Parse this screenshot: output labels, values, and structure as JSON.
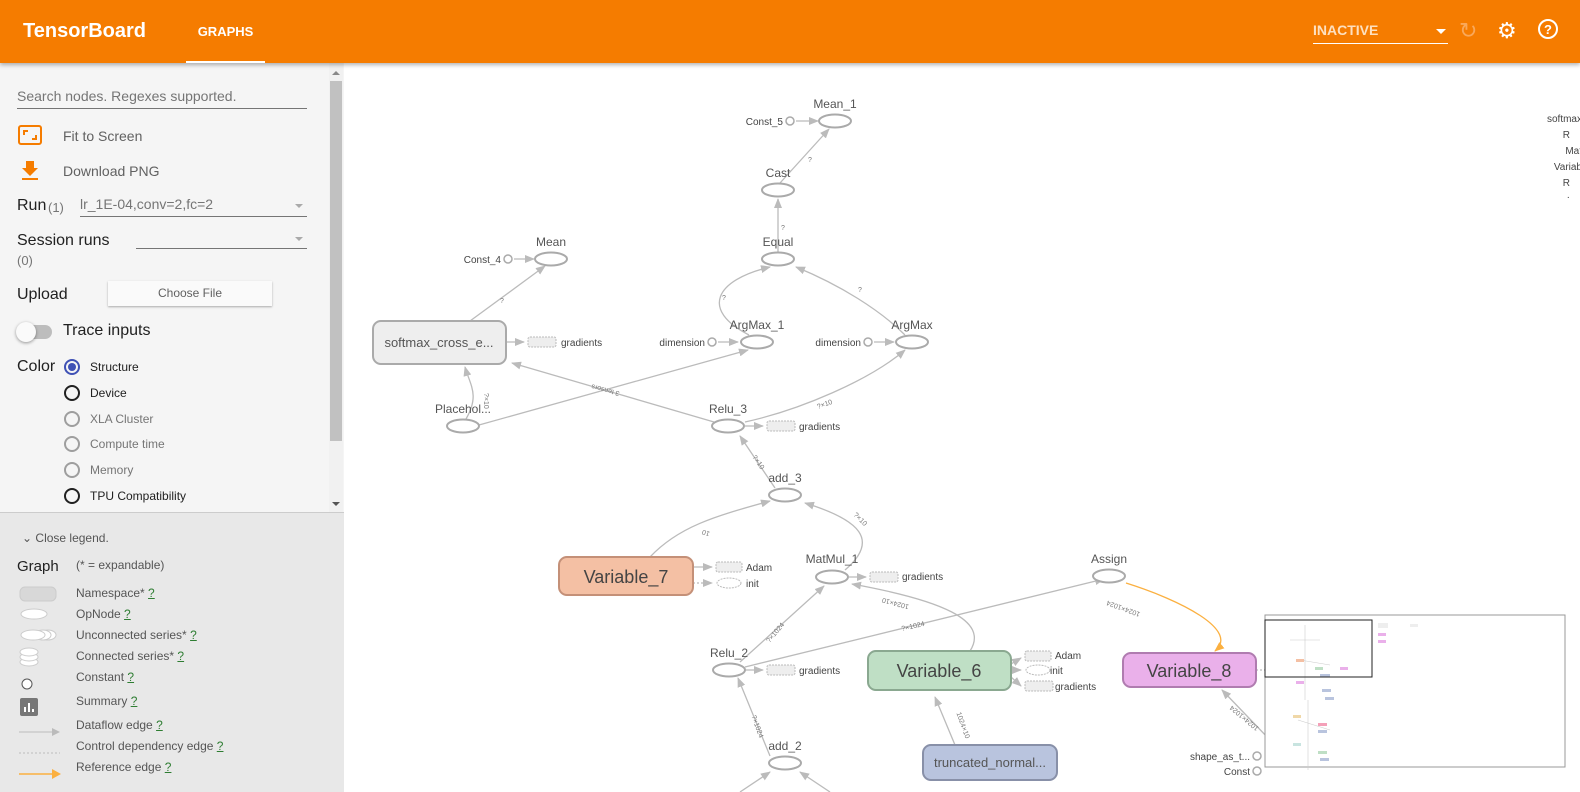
{
  "header": {
    "title": "TensorBoard",
    "tab": "GRAPHS",
    "run_status": "INACTIVE",
    "icons": [
      "refresh-icon",
      "gear-icon",
      "help-icon"
    ]
  },
  "sidebar": {
    "search_placeholder": "Search nodes. Regexes supported.",
    "fit_label": "Fit to Screen",
    "download_label": "Download PNG",
    "run_label": "Run",
    "run_count": "(1)",
    "run_value": "lr_1E-04,conv=2,fc=2",
    "session_label": "Session runs",
    "session_count": "(0)",
    "session_value": "",
    "upload_label": "Upload",
    "choose_file": "Choose File",
    "trace_label": "Trace inputs",
    "trace_on": false,
    "color_label": "Color",
    "color_options": [
      {
        "label": "Structure",
        "selected": true
      },
      {
        "label": "Device"
      },
      {
        "label": "XLA Cluster"
      },
      {
        "label": "Compute time"
      },
      {
        "label": "Memory"
      },
      {
        "label": "TPU Compatibility"
      }
    ],
    "accent": "#f57c00"
  },
  "legend": {
    "close": "Close legend.",
    "title": "Graph",
    "subtitle": "(* = expandable)",
    "help": "?",
    "items": [
      "Namespace*",
      "OpNode",
      "Unconnected series*",
      "Connected series*",
      "Constant",
      "Summary",
      "Dataflow edge",
      "Control dependency edge",
      "Reference edge"
    ]
  },
  "graph": {
    "nodes": {
      "mean_1": "Mean_1",
      "const_5": "Const_5",
      "cast": "Cast",
      "equal": "Equal",
      "mean": "Mean",
      "const_4": "Const_4",
      "softmax": "softmax_cross_e...",
      "argmax_1": "ArgMax_1",
      "argmax": "ArgMax",
      "dimension": "dimension",
      "placeholder": "Placehol...",
      "relu_3": "Relu_3",
      "add_3": "add_3",
      "variable_7": "Variable_7",
      "matmul_1": "MatMul_1",
      "assign": "Assign",
      "relu_2": "Relu_2",
      "variable_6": "Variable_6",
      "variable_8": "Variable_8",
      "add_2": "add_2",
      "truncated": "truncated_normal...",
      "shape_as": "shape_as_t...",
      "const": "Const",
      "gradients": "gradients",
      "adam": "Adam",
      "init": "init"
    },
    "edge_labels": {
      "q": "?",
      "tensors3": "3 tensors",
      "x10": "?×10",
      "ten": "10",
      "x1024": "?×1024",
      "w1024x10": "1024×10",
      "w1024x1024": "1024×1024"
    },
    "right_labels": [
      "softmax",
      "R",
      "Mat",
      "Variab",
      "R",
      "·"
    ],
    "colors": {
      "variable_7": "#f4c0a4",
      "variable_6": "#bfdfc5",
      "variable_8": "#eab0ea",
      "truncated": "#b9c4de",
      "namespace": "#eeeeee",
      "reference_edge": "#fbb040"
    }
  }
}
